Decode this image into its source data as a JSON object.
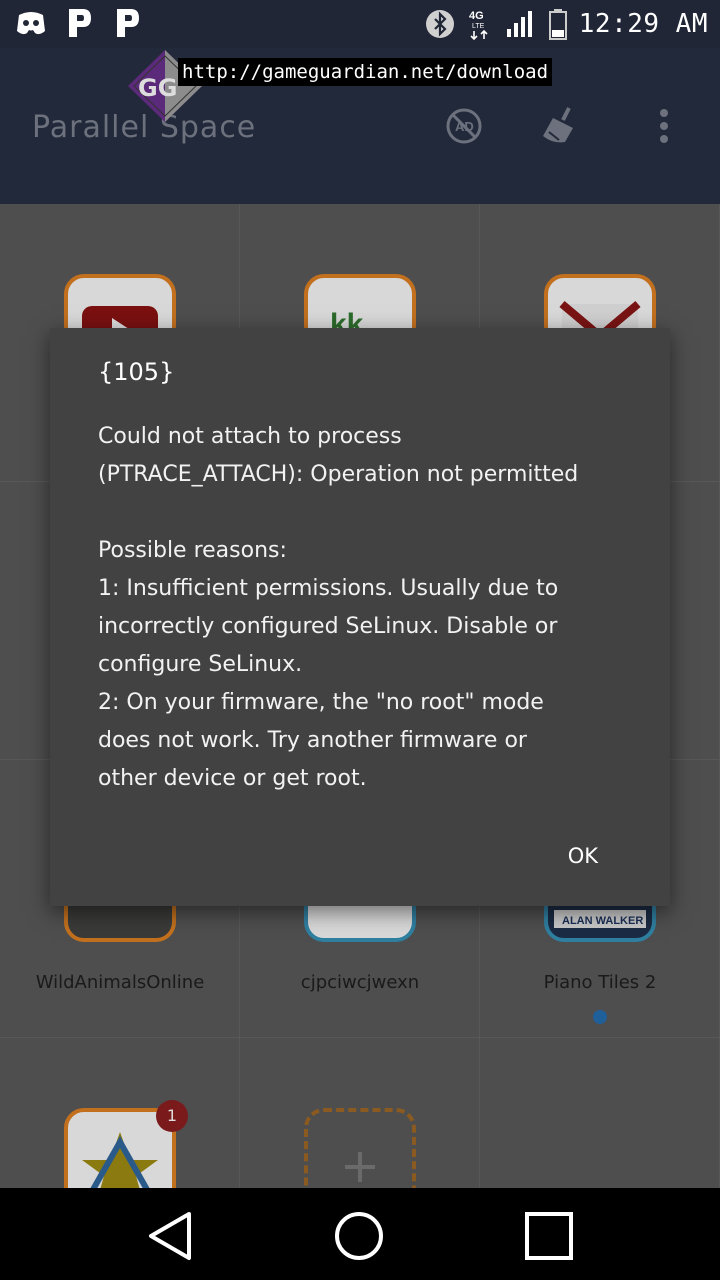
{
  "status_bar": {
    "time": "12:29 AM",
    "network": "4G"
  },
  "app": {
    "title": "Parallel Space",
    "overlay_url": "http://gameguardian.net/download"
  },
  "apps": [
    {
      "label": ""
    },
    {
      "label": ""
    },
    {
      "label": ""
    },
    {
      "label": "WildAnimalsOnline"
    },
    {
      "label": "cjpciwcjwexn"
    },
    {
      "label": "Piano Tiles 2"
    },
    {
      "label": ""
    },
    {
      "label": ""
    }
  ],
  "badge_count": "1",
  "dialog": {
    "title": "{105}",
    "message": "Could not attach to process\n(PTRACE_ATTACH): Operation not permitted\n\nPossible reasons:\n1: Insufficient permissions. Usually due to\nincorrectly configured SeLinux. Disable or\nconfigure SeLinux.\n2: On your firmware, the \"no root\" mode\ndoes not work. Try another firmware or\nother device or get root.",
    "ok_label": "OK"
  },
  "colors": {
    "app_bar": "#22293a",
    "dialog_bg": "#424242",
    "accent": "#1f5f9a"
  }
}
